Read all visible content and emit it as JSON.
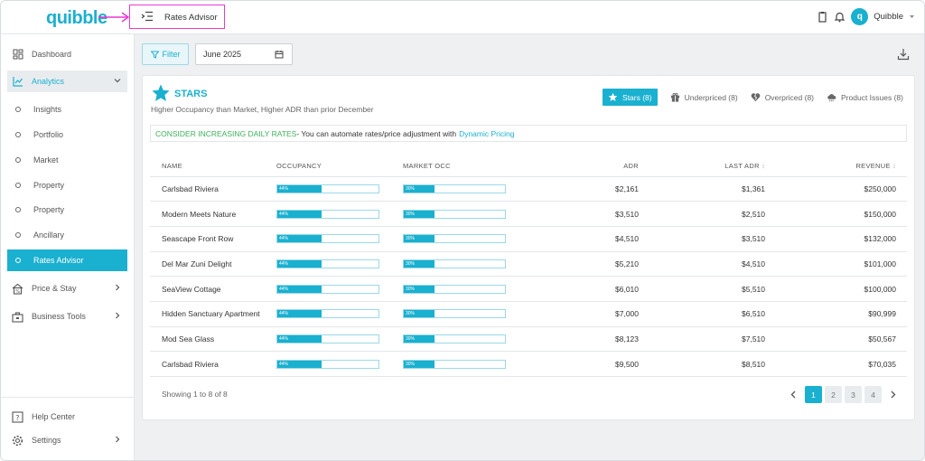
{
  "app": {
    "logo": "quibble",
    "page_title": "Rates Advisor",
    "user_name": "Quibble",
    "user_initial": "q"
  },
  "colors": {
    "accent": "#1ab0cf",
    "annotation": "#e83ad0",
    "green": "#3db15a"
  },
  "sidebar": {
    "items": [
      {
        "label": "Dashboard",
        "icon": "dashboard-icon"
      },
      {
        "label": "Analytics",
        "icon": "analytics-icon"
      },
      {
        "label": "Insights"
      },
      {
        "label": "Portfolio"
      },
      {
        "label": "Market"
      },
      {
        "label": "Property"
      },
      {
        "label": "Property"
      },
      {
        "label": "Ancillary"
      },
      {
        "label": "Rates Advisor"
      },
      {
        "label": "Price & Stay",
        "icon": "house-percent-icon"
      },
      {
        "label": "Business Tools",
        "icon": "briefcase-icon"
      },
      {
        "label": "Help Center",
        "icon": "help-icon"
      },
      {
        "label": "Settings",
        "icon": "gear-icon"
      }
    ]
  },
  "toolbar": {
    "filter_label": "Filter",
    "month_value": "June 2025"
  },
  "card": {
    "title": "STARS",
    "subtitle": "Higher Occupancy than Market, Higher ADR than prior December",
    "tabs": [
      {
        "label": "Stars (8)",
        "icon": "star-icon"
      },
      {
        "label": "Underpriced (8)",
        "icon": "gift-icon"
      },
      {
        "label": "Overpriced (8)",
        "icon": "broken-heart-icon"
      },
      {
        "label": "Product Issues (8)",
        "icon": "cloud-icon"
      }
    ],
    "notice_highlight": "CONSIDER INCREASING DAILY RATES",
    "notice_text": " - You can automate rates/price adjustment with",
    "notice_link": "Dynamic Pricing"
  },
  "table": {
    "headers": {
      "name": "NAME",
      "occupancy": "OCCUPANCY",
      "market_occ": "MARKET OCC",
      "adr": "ADR",
      "last_adr": "LAST ADR",
      "revenue": "REVENUE"
    },
    "rows": [
      {
        "name": "Carlsbad Riviera",
        "occupancy": 44,
        "occ_label": "44%",
        "market_occ": 30,
        "mkt_label": "30%",
        "adr": "$2,161",
        "last_adr": "$1,361",
        "revenue": "$250,000"
      },
      {
        "name": "Modern Meets Nature",
        "occupancy": 44,
        "occ_label": "44%",
        "market_occ": 30,
        "mkt_label": "30%",
        "adr": "$3,510",
        "last_adr": "$2,510",
        "revenue": "$150,000"
      },
      {
        "name": "Seascape Front Row",
        "occupancy": 44,
        "occ_label": "44%",
        "market_occ": 30,
        "mkt_label": "30%",
        "adr": "$4,510",
        "last_adr": "$3,510",
        "revenue": "$132,000"
      },
      {
        "name": "Del Mar  Zuni Delight",
        "occupancy": 44,
        "occ_label": "44%",
        "market_occ": 30,
        "mkt_label": "30%",
        "adr": "$5,210",
        "last_adr": "$4,510",
        "revenue": "$101,000"
      },
      {
        "name": "SeaView Cottage",
        "occupancy": 44,
        "occ_label": "44%",
        "market_occ": 30,
        "mkt_label": "30%",
        "adr": "$6,010",
        "last_adr": "$5,510",
        "revenue": "$100,000"
      },
      {
        "name": "Hidden Sanctuary Apartment",
        "occupancy": 44,
        "occ_label": "44%",
        "market_occ": 30,
        "mkt_label": "30%",
        "adr": "$7,000",
        "last_adr": "$6,510",
        "revenue": "$90,999"
      },
      {
        "name": "Mod Sea Glass",
        "occupancy": 44,
        "occ_label": "44%",
        "market_occ": 30,
        "mkt_label": "30%",
        "adr": "$8,123",
        "last_adr": "$7,510",
        "revenue": "$50,567"
      },
      {
        "name": "Carlsbad Riviera",
        "occupancy": 44,
        "occ_label": "44%",
        "market_occ": 30,
        "mkt_label": "30%",
        "adr": "$9,500",
        "last_adr": "$8,510",
        "revenue": "$70,035"
      }
    ],
    "showing": "Showing 1 to 8 of 8",
    "pages": [
      "1",
      "2",
      "3",
      "4"
    ]
  }
}
